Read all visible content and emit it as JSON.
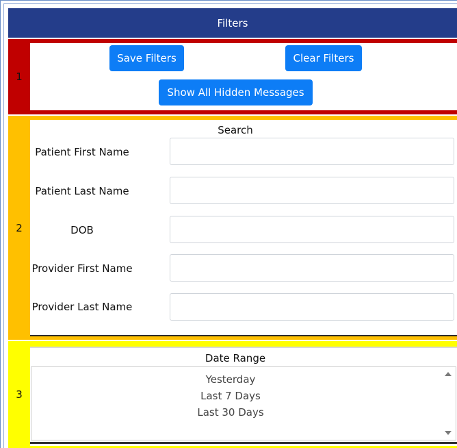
{
  "header": {
    "title": "Filters"
  },
  "sections": {
    "one": {
      "marker": "1"
    },
    "two": {
      "marker": "2"
    },
    "three": {
      "marker": "3"
    }
  },
  "actions": {
    "save_label": "Save Filters",
    "clear_label": "Clear Filters",
    "show_hidden_label": "Show All Hidden Messages"
  },
  "search": {
    "title": "Search",
    "fields": [
      {
        "label": "Patient First Name",
        "value": ""
      },
      {
        "label": "Patient Last Name",
        "value": ""
      },
      {
        "label": "DOB",
        "value": ""
      },
      {
        "label": "Provider First Name",
        "value": ""
      },
      {
        "label": "Provider Last Name",
        "value": ""
      }
    ]
  },
  "date_range": {
    "title": "Date Range",
    "options": [
      "Yesterday",
      "Last 7 Days",
      "Last 30 Days"
    ]
  },
  "colors": {
    "header_bg": "#243d8a",
    "section1": "#c00000",
    "section2": "#ffc000",
    "section3": "#ffff00",
    "button": "#0d7df6"
  }
}
